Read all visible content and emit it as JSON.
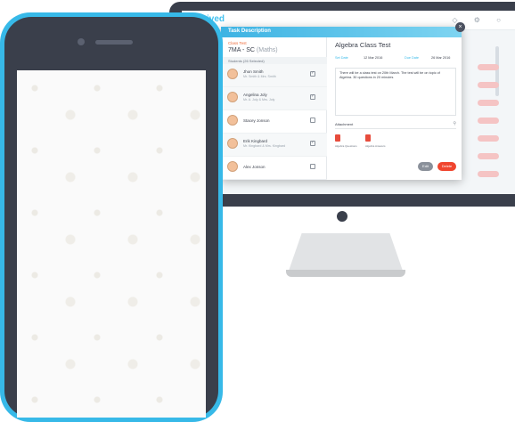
{
  "app": {
    "logo_text": "ived",
    "header_icons": "◇ ⚙ ○"
  },
  "modal": {
    "header_title": "Task Description",
    "close_icon": "×",
    "class_test_label": "Class Test",
    "class_name": "7MA - SC",
    "class_subject": "(Maths)",
    "students_header": "Students (26 Selected)",
    "students": [
      {
        "name": "Jhon Smith",
        "parents": "Mr. Smith & Mrs. Smith",
        "checked": true
      },
      {
        "name": "Angelina Joly",
        "parents": "Mr. A. Joly & Mrs. Joly",
        "checked": true
      },
      {
        "name": "Stacey Jonson",
        "parents": "",
        "checked": false
      },
      {
        "name": "Erik Kingbard",
        "parents": "Mr. Kingbard & Mrs. Kingbard",
        "checked": true
      },
      {
        "name": "Alex Jonson",
        "parents": "",
        "checked": false
      }
    ],
    "task_title": "Algebra Class Test",
    "set_date_label": "Set Date",
    "set_date_value": "12 Mar 2016",
    "due_date_label": "Due Date",
    "due_date_value": "26 Mar 2016",
    "description": "There will be a class test on 20th March. The test will be on topic of Algebra. 30 questions in 20 minutes",
    "attachment_label": "Attachment",
    "attachments": [
      {
        "name": "Algebra Questions"
      },
      {
        "name": "Algebra Answers"
      }
    ],
    "edit_label": "Edit",
    "delete_label": "Delete"
  },
  "colors": {
    "accent": "#37b9e8",
    "device_dark": "#3a3f4b",
    "delete": "#f0452e",
    "class_test": "#ef6c3b"
  }
}
